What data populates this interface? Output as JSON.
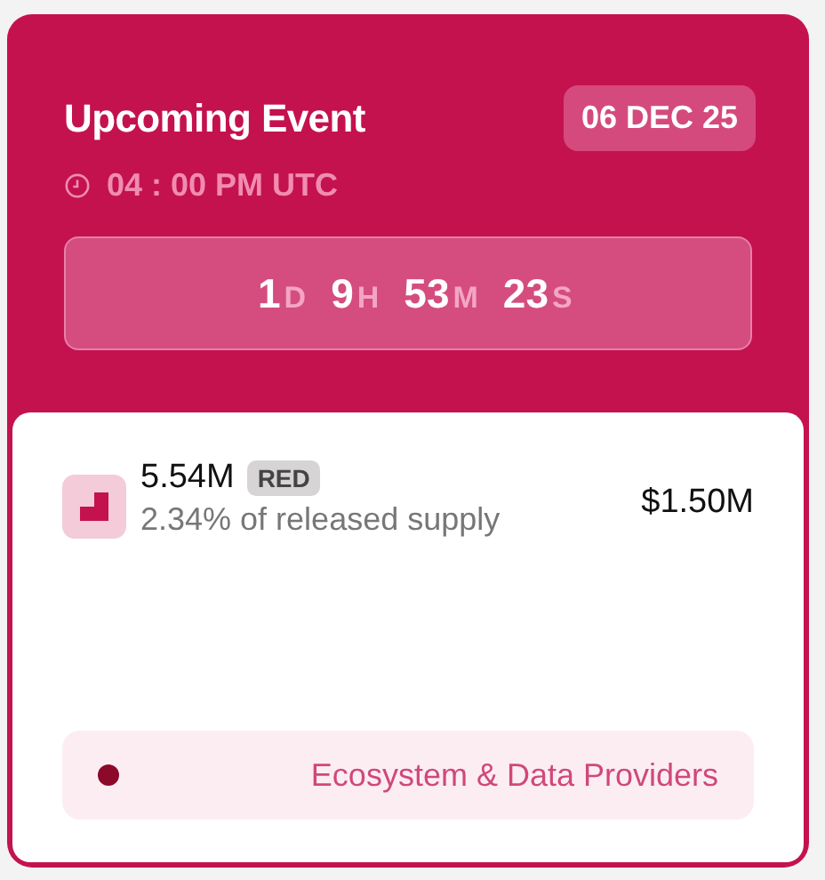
{
  "event": {
    "title": "Upcoming Event",
    "date": "06 DEC 25",
    "time": "04 : 00 PM UTC",
    "countdown": [
      {
        "value": "1",
        "unit": "D"
      },
      {
        "value": "9",
        "unit": "H"
      },
      {
        "value": "53",
        "unit": "M"
      },
      {
        "value": "23",
        "unit": "S"
      }
    ]
  },
  "unlock": {
    "amount": "5.54M",
    "ticker": "RED",
    "share": "2.34% of released supply",
    "value": "$1.50M"
  },
  "category": {
    "label": "Ecosystem & Data Providers",
    "color": "#8b0a2a"
  }
}
